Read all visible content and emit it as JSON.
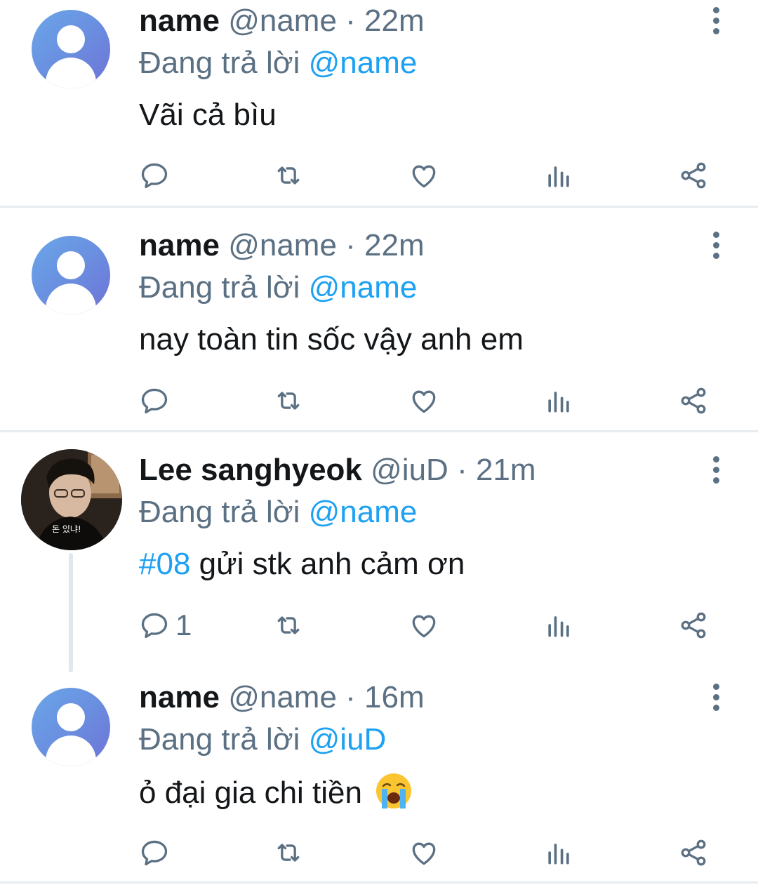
{
  "tweets": [
    {
      "display_name": "name",
      "handle": "@name",
      "separator": "·",
      "time": "22m",
      "reply_prefix": "Đang trả lời",
      "reply_to": "@name",
      "text": "Vãi cả bìu",
      "avatar_icon": "default-user-icon"
    },
    {
      "display_name": "name",
      "handle": "@name",
      "separator": "·",
      "time": "22m",
      "reply_prefix": "Đang trả lời",
      "reply_to": "@name",
      "text": "nay toàn tin sốc vậy anh em",
      "avatar_icon": "default-user-icon"
    },
    {
      "display_name": "Lee sanghyeok",
      "handle": "@iuD",
      "separator": "·",
      "time": "21m",
      "reply_prefix": "Đang trả lời",
      "reply_to": "@name",
      "hashtag": "#08",
      "text": "gửi stk anh cảm ơn",
      "reply_count": "1",
      "avatar_icon": "profile-photo"
    },
    {
      "display_name": "name",
      "handle": "@name",
      "separator": "·",
      "time": "16m",
      "reply_prefix": "Đang trả lời",
      "reply_to": "@iuD",
      "text": "ỏ đại gia chi tiền",
      "emoji": "loudly-crying-face",
      "avatar_icon": "default-user-icon"
    }
  ],
  "action_icons": [
    "reply-icon",
    "retweet-icon",
    "like-icon",
    "analytics-icon",
    "share-icon"
  ],
  "colors": {
    "accent": "#1da1f2",
    "secondary_text": "#5b7083",
    "icon": "#5b7083",
    "divider": "#e6ecf0"
  }
}
